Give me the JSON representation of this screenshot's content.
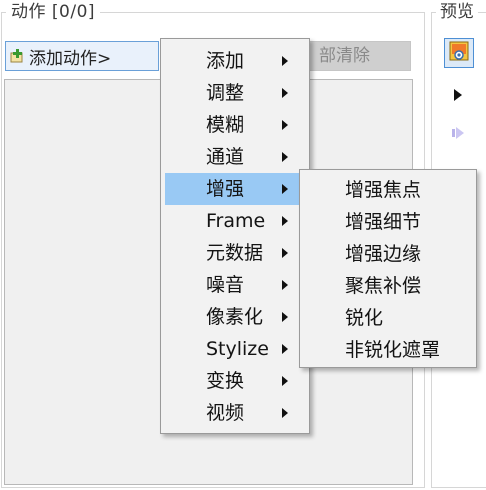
{
  "actions": {
    "title": "动作 [0/0]",
    "add_label": "添加动作>",
    "clear_label": "部清除"
  },
  "preview": {
    "title": "预览"
  },
  "icons": {
    "add": "add-plus-icon",
    "preview": "image-icon",
    "play": "play-icon",
    "step": "step-forward-icon",
    "submenu_arrow": "submenu-arrow-icon"
  },
  "colors": {
    "highlight": "#99c9f4",
    "add_button_bg": "#e9f1fb",
    "add_button_border": "#6aa0d8"
  },
  "menu": {
    "items": [
      {
        "label": "添加"
      },
      {
        "label": "调整"
      },
      {
        "label": "模糊"
      },
      {
        "label": "通道"
      },
      {
        "label": "增强"
      },
      {
        "label": "Frame"
      },
      {
        "label": "元数据"
      },
      {
        "label": "噪音"
      },
      {
        "label": "像素化"
      },
      {
        "label": "Stylize"
      },
      {
        "label": "变换"
      },
      {
        "label": "视频"
      }
    ],
    "highlighted": "增强"
  },
  "submenu": {
    "items": [
      {
        "label": "增强焦点"
      },
      {
        "label": "增强细节"
      },
      {
        "label": "增强边缘"
      },
      {
        "label": "聚焦补偿"
      },
      {
        "label": "锐化"
      },
      {
        "label": "非锐化遮罩"
      }
    ]
  }
}
